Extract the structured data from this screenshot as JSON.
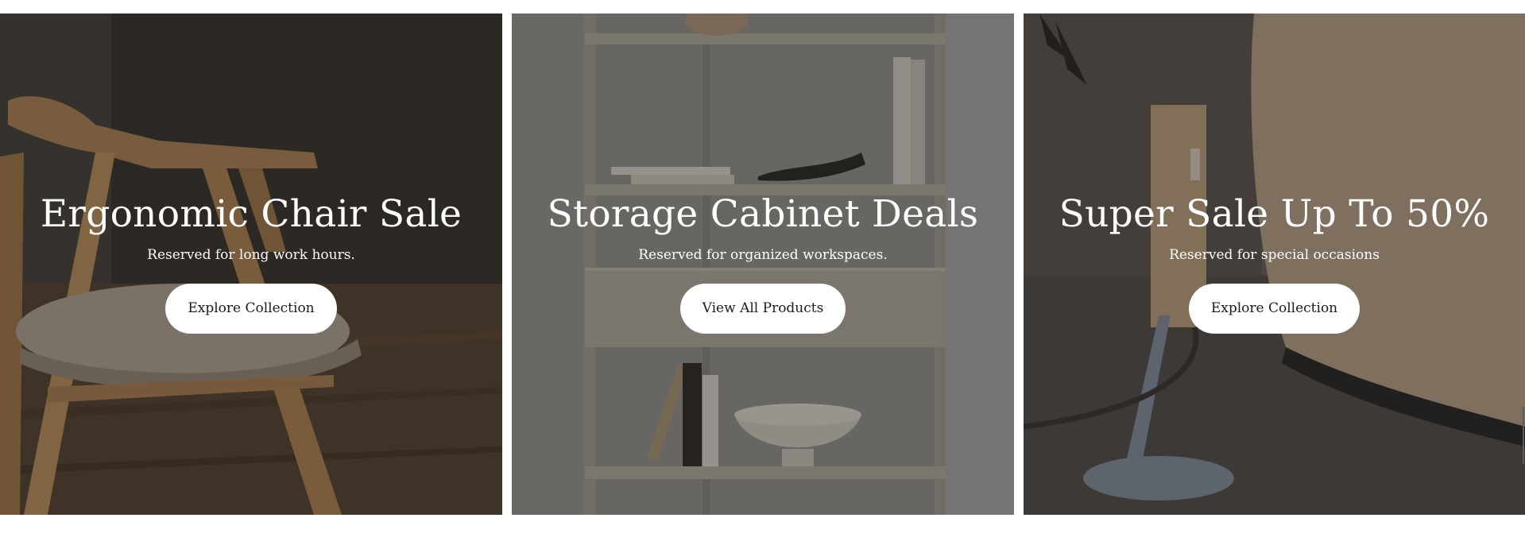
{
  "banners": [
    {
      "title": "Ergonomic Chair Sale",
      "subtitle": "Reserved for long work hours.",
      "button_label": "Explore Collection"
    },
    {
      "title": "Storage Cabinet Deals",
      "subtitle": "Reserved for organized workspaces.",
      "button_label": "View All Products"
    },
    {
      "title": "Super Sale Up To 50%",
      "subtitle": "Reserved for special occasions",
      "button_label": "Explore Collection"
    }
  ],
  "colors": {
    "text": "#ffffff",
    "button_bg": "#ffffff",
    "button_text": "#1c1c1c"
  }
}
